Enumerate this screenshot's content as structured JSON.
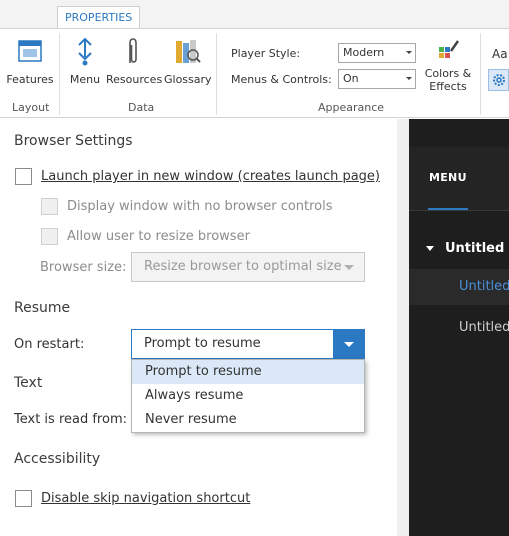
{
  "ribbon": {
    "tab": "PROPERTIES",
    "buttons": {
      "features": "Features",
      "menu": "Menu",
      "resources": "Resources",
      "glossary": "Glossary",
      "colors_effects_line1": "Colors &",
      "colors_effects_line2": "Effects",
      "text_styles": "Aa"
    },
    "groups": {
      "layout": "Layout",
      "data": "Data",
      "appearance": "Appearance"
    },
    "player_style": {
      "label": "Player Style:",
      "value": "Modern"
    },
    "menus_controls": {
      "label": "Menus & Controls:",
      "value": "On"
    }
  },
  "settings": {
    "browser": {
      "heading": "Browser Settings",
      "launch_new_window": "Launch player in new window (creates launch page)",
      "no_browser_controls": "Display window with no browser controls",
      "allow_resize": "Allow user to resize browser",
      "size_label": "Browser size:",
      "size_value": "Resize browser to optimal size"
    },
    "resume": {
      "heading": "Resume",
      "on_restart_label": "On restart:",
      "selected": "Prompt to resume",
      "options": [
        "Prompt to resume",
        "Always resume",
        "Never resume"
      ]
    },
    "text": {
      "heading": "Text",
      "read_from_label": "Text is read from:"
    },
    "accessibility": {
      "heading": "Accessibility",
      "disable_skip_nav": "Disable skip navigation shortcut"
    }
  },
  "preview": {
    "menu_tab": "MENU",
    "scene_title": "Untitled Sc",
    "slide1": "Untitled",
    "slide2": "Untitled"
  },
  "colors": {
    "accent": "#2b79c2",
    "preview_bg": "#1e1e1e"
  }
}
